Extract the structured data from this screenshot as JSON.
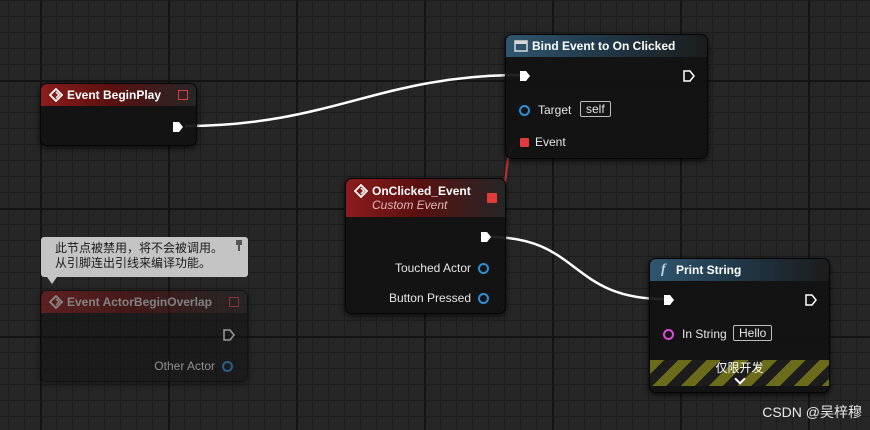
{
  "nodes": {
    "event_begin_play": {
      "title": "Event BeginPlay"
    },
    "bind_event": {
      "title": "Bind Event to On Clicked",
      "target_label": "Target",
      "target_value": "self",
      "event_label": "Event"
    },
    "onclicked_event": {
      "title": "OnClicked_Event",
      "subtitle": "Custom Event",
      "pins": [
        "Touched Actor",
        "Button Pressed"
      ]
    },
    "actor_begin_overlap": {
      "title": "Event ActorBeginOverlap",
      "pin_other_actor": "Other Actor",
      "disabled_comment": [
        "此节点被禁用，将不会被调用。",
        "从引脚连出引线来编译功能。"
      ]
    },
    "print_string": {
      "title": "Print String",
      "icon_glyph": "f",
      "in_string_label": "In String",
      "in_string_value": "Hello",
      "dev_only_label": "仅限开发"
    }
  },
  "colors": {
    "exec_wire": "#ffffff",
    "delegate_pin": "#e23b3b",
    "object_pin": "#2d8fd5",
    "string_pin": "#e04ad6"
  },
  "watermark": "CSDN @吴梓穆"
}
